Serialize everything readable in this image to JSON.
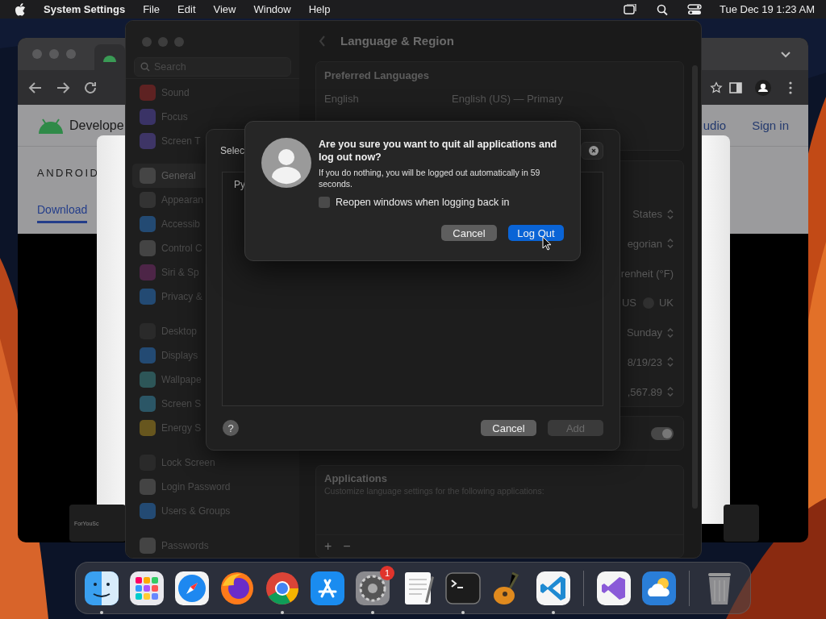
{
  "menu_bar": {
    "app": "System Settings",
    "menus": [
      "File",
      "Edit",
      "View",
      "Window",
      "Help"
    ],
    "clock": "Tue Dec 19  1:23 AM"
  },
  "browser": {
    "brand": "Develope",
    "header_right": [
      "udio",
      "Sign in"
    ],
    "heading": "ANDROID",
    "link": "Download"
  },
  "back_panel": {
    "tab_label": "ForYouSc"
  },
  "settings": {
    "search": {
      "placeholder": "Search"
    },
    "sidebar": {
      "groups": [
        {
          "items": [
            {
              "label": "Sound",
              "selected": false
            },
            {
              "label": "Focus",
              "selected": false
            },
            {
              "label": "Screen T",
              "selected": false
            }
          ]
        },
        {
          "items": [
            {
              "label": "General",
              "selected": true
            },
            {
              "label": "Appearan",
              "selected": false
            },
            {
              "label": "Accessib",
              "selected": false
            },
            {
              "label": "Control C",
              "selected": false
            },
            {
              "label": "Siri & Sp",
              "selected": false
            },
            {
              "label": "Privacy &",
              "selected": false
            }
          ]
        },
        {
          "items": [
            {
              "label": "Desktop",
              "selected": false
            },
            {
              "label": "Displays",
              "selected": false
            },
            {
              "label": "Wallpape",
              "selected": false
            },
            {
              "label": "Screen S",
              "selected": false
            },
            {
              "label": "Energy S",
              "selected": false
            }
          ]
        },
        {
          "items": [
            {
              "label": "Lock Screen",
              "selected": false
            },
            {
              "label": "Login Password",
              "selected": false
            },
            {
              "label": "Users & Groups",
              "selected": false
            }
          ]
        },
        {
          "items": [
            {
              "label": "Passwords",
              "selected": false
            }
          ]
        }
      ]
    },
    "title": "Language & Region",
    "preferred_languages": {
      "title": "Preferred Languages",
      "rows": [
        {
          "name": "English",
          "detail": "English (US) — Primary"
        }
      ]
    },
    "region_rows": [
      {
        "kind": "popup",
        "value": "States"
      },
      {
        "kind": "popup",
        "value": "egorian"
      },
      {
        "kind": "text",
        "value": "renheit (°F)"
      },
      {
        "kind": "radio",
        "options": [
          {
            "label": "US"
          },
          {
            "label": "UK",
            "selected": false
          }
        ]
      },
      {
        "kind": "popup",
        "value": "Sunday"
      },
      {
        "kind": "popup",
        "value": "8/19/23"
      },
      {
        "kind": "popup",
        "value": ",567.89"
      }
    ],
    "toggle": {
      "on": true
    },
    "applications": {
      "title": "Applications",
      "subtitle": "Customize language settings for the following applications:",
      "buttons": [
        "+",
        "−"
      ]
    }
  },
  "language_sheet": {
    "title": "Selec",
    "items": [
      "Py"
    ],
    "help": "?",
    "buttons": [
      {
        "label": "Cancel",
        "disabled": false
      },
      {
        "label": "Add",
        "disabled": true
      }
    ]
  },
  "logout_dialog": {
    "title": "Are you sure you want to quit all applications and log out now?",
    "message": "If you do nothing, you will be logged out automatically in 59 seconds.",
    "checkbox": {
      "label": "Reopen windows when logging back in",
      "checked": false
    },
    "buttons": [
      {
        "label": "Cancel",
        "default": false
      },
      {
        "label": "Log Out",
        "default": true
      }
    ]
  },
  "dock": {
    "items": [
      {
        "kind": "finder",
        "running": true
      },
      {
        "kind": "launchpad",
        "running": false
      },
      {
        "kind": "safari",
        "running": false
      },
      {
        "kind": "firefox",
        "running": false
      },
      {
        "kind": "chrome",
        "running": true
      },
      {
        "kind": "appstore",
        "running": false
      },
      {
        "kind": "settings",
        "running": true,
        "badge": "1"
      },
      {
        "kind": "textedit",
        "running": false
      },
      {
        "kind": "terminal",
        "running": true
      },
      {
        "kind": "guitar",
        "running": false
      },
      {
        "kind": "vscode",
        "running": true
      },
      {
        "kind": "divider"
      },
      {
        "kind": "visualstudio",
        "running": false
      },
      {
        "kind": "weather",
        "running": false
      },
      {
        "kind": "divider"
      },
      {
        "kind": "trash",
        "running": false
      }
    ]
  }
}
